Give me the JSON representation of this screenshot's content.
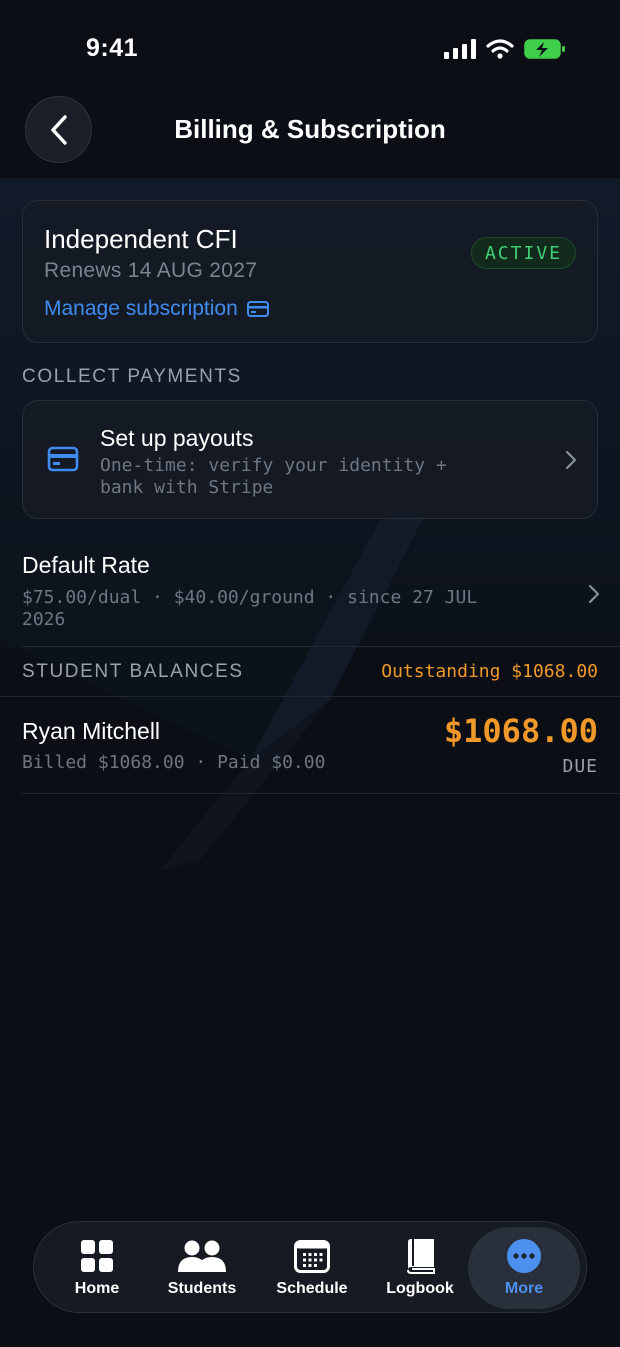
{
  "status_bar": {
    "time": "9:41"
  },
  "header": {
    "title": "Billing & Subscription",
    "back_icon": "chevron-left-icon"
  },
  "plan": {
    "name": "Independent CFI",
    "renews": "Renews 14 AUG 2027",
    "status": "ACTIVE",
    "manage_label": "Manage subscription",
    "manage_icon": "credit-card-icon"
  },
  "collect_payments": {
    "section_label": "COLLECT PAYMENTS",
    "payout": {
      "title": "Set up payouts",
      "subtitle": "One-time: verify your identity + bank with Stripe",
      "icon": "credit-card-icon"
    }
  },
  "default_rate": {
    "title": "Default Rate",
    "subtitle": "$75.00/dual · $40.00/ground · since 27 JUL 2026"
  },
  "student_balances": {
    "section_label": "STUDENT BALANCES",
    "outstanding": "Outstanding $1068.00",
    "students": [
      {
        "name": "Ryan Mitchell",
        "summary": "Billed $1068.00 · Paid $0.00",
        "amount": "$1068.00",
        "status": "DUE"
      }
    ]
  },
  "tabs": [
    {
      "label": "Home",
      "icon": "grid-icon"
    },
    {
      "label": "Students",
      "icon": "people-icon"
    },
    {
      "label": "Schedule",
      "icon": "calendar-icon"
    },
    {
      "label": "Logbook",
      "icon": "book-icon"
    },
    {
      "label": "More",
      "icon": "more-icon",
      "active": true
    }
  ],
  "colors": {
    "background": "#0b0e14",
    "accent_blue": "#3f8cf0",
    "active_green": "#3fcf74",
    "due_orange": "#f0992a",
    "muted_text": "#6f7682"
  }
}
